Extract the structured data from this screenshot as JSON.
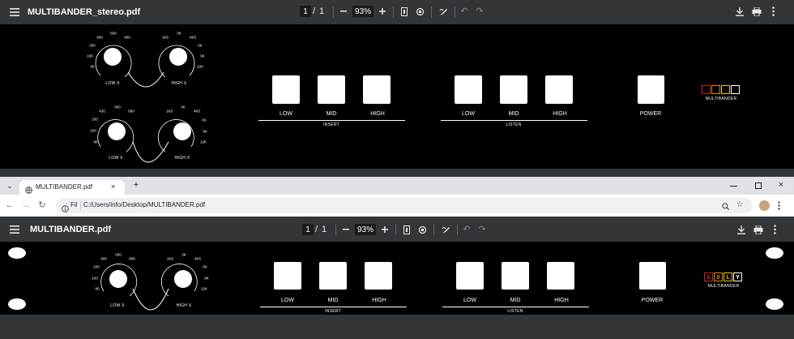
{
  "viewer1": {
    "title": "MULTIBANDER_stereo.pdf",
    "page_current": "1",
    "page_sep": "/",
    "page_total": "1",
    "zoom": "93%"
  },
  "viewer2": {
    "title": "MULTIBANDER.pdf",
    "page_current": "1",
    "page_sep": "/",
    "page_total": "1",
    "zoom": "93%"
  },
  "browser": {
    "tab_title": "MULTIBANDER.pdf",
    "new_tab": "+",
    "address_prefix": "Fil",
    "address": "C:/Users/info/Desktop/MULTIBANDER.pdf"
  },
  "panel": {
    "low_x": "LOW X",
    "high_x": "HIGH X",
    "low_ticks": [
      "80",
      "100",
      "200",
      "400",
      "600",
      "800"
    ],
    "high_ticks": [
      "1K5",
      "3K",
      "4K5",
      "6K",
      "9K",
      "12K"
    ],
    "insert": {
      "group": "INSERT",
      "low": "LOW",
      "mid": "MID",
      "high": "HIGH"
    },
    "listen": {
      "group": "LISTEN",
      "low": "LOW",
      "mid": "MID",
      "high": "HIGH"
    },
    "power": "POWER",
    "brand": "MULTIBANDER",
    "logo_letters": [
      "G",
      "O",
      "L",
      "Y"
    ]
  },
  "panel_stereo_low_ticks_b": [
    "80",
    "100",
    "200",
    "430",
    "600",
    "800"
  ],
  "colors": {
    "toolbar_bg": "#323639",
    "panel_bg": "#000000",
    "logo_red": "#cc2222",
    "logo_orange": "#dd8800",
    "logo_yellow": "#e8c800",
    "logo_white": "#ffffff"
  }
}
